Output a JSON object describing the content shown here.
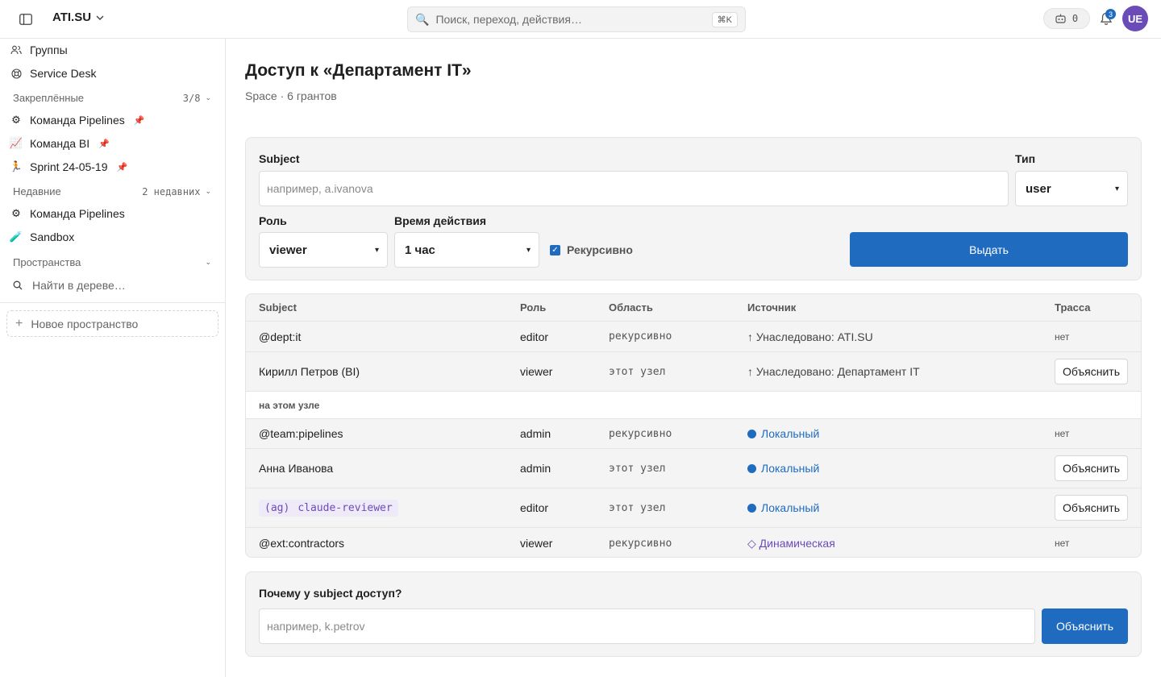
{
  "topbar": {
    "org_name": "ATI.SU",
    "search_placeholder": "Поиск, переход, действия…",
    "search_shortcut": "⌘K",
    "bot_count": "0",
    "notifications_count": "3",
    "avatar_initials": "UE"
  },
  "sidebar": {
    "items_top": [
      {
        "label": "Группы",
        "icon": "users-icon"
      },
      {
        "label": "Service Desk",
        "icon": "lifebuoy-icon"
      }
    ],
    "pinned": {
      "title": "Закреплённые",
      "count": "3/8",
      "items": [
        {
          "label": "Команда Pipelines",
          "emoji": "⚙"
        },
        {
          "label": "Команда BI",
          "emoji": "📈"
        },
        {
          "label": "Sprint 24-05-19",
          "emoji": "🏃"
        }
      ]
    },
    "recent": {
      "title": "Недавние",
      "count": "2 недавних",
      "items": [
        {
          "label": "Команда Pipelines",
          "emoji": "⚙"
        },
        {
          "label": "Sandbox",
          "emoji": "🧪"
        }
      ]
    },
    "spaces": {
      "title": "Пространства"
    },
    "find_placeholder": "Найти в дереве…",
    "new_space_label": "Новое пространство"
  },
  "page": {
    "title": "Доступ к «Департамент IT»",
    "subtitle": "Space · 6 грантов"
  },
  "grant_form": {
    "subject_label": "Subject",
    "subject_placeholder": "например, a.ivanova",
    "type_label": "Тип",
    "type_value": "user",
    "role_label": "Роль",
    "role_value": "viewer",
    "duration_label": "Время действия",
    "duration_value": "1 час",
    "recursive_label": "Рекурсивно",
    "recursive_checked": true,
    "submit_label": "Выдать"
  },
  "table": {
    "headers": [
      "Subject",
      "Роль",
      "Область",
      "Источник",
      "Трасса"
    ],
    "inherited_rows": [
      {
        "subject": "@dept:it",
        "role": "editor",
        "area": "рекурсивно",
        "source": "↑ Унаследовано: ATI.SU",
        "trace": "нет"
      },
      {
        "subject": "Кирилл Петров (BI)",
        "role": "viewer",
        "area": "этот узел",
        "source": "↑ Унаследовано: Департамент IT",
        "trace_button": "Объяснить"
      }
    ],
    "local_section_label": "на этом узле",
    "local_rows": [
      {
        "subject": "@team:pipelines",
        "role": "admin",
        "area": "рекурсивно",
        "source": "Локальный",
        "trace": "нет"
      },
      {
        "subject": "Анна Иванова",
        "role": "admin",
        "area": "этот узел",
        "source": "Локальный",
        "trace_button": "Объяснить"
      },
      {
        "subject_tag": "(ag)",
        "subject": "claude-reviewer",
        "role": "editor",
        "area": "этот узел",
        "source": "Локальный",
        "trace_button": "Объяснить"
      },
      {
        "subject": "@ext:contractors",
        "role": "viewer",
        "area": "рекурсивно",
        "source": "◇ Динамическая",
        "trace": "нет"
      }
    ]
  },
  "explain_form": {
    "title": "Почему у subject доступ?",
    "placeholder": "например, k.petrov",
    "button_label": "Объяснить"
  },
  "colors": {
    "accent": "#1e6bbf",
    "agent": "#6b4bb7"
  }
}
